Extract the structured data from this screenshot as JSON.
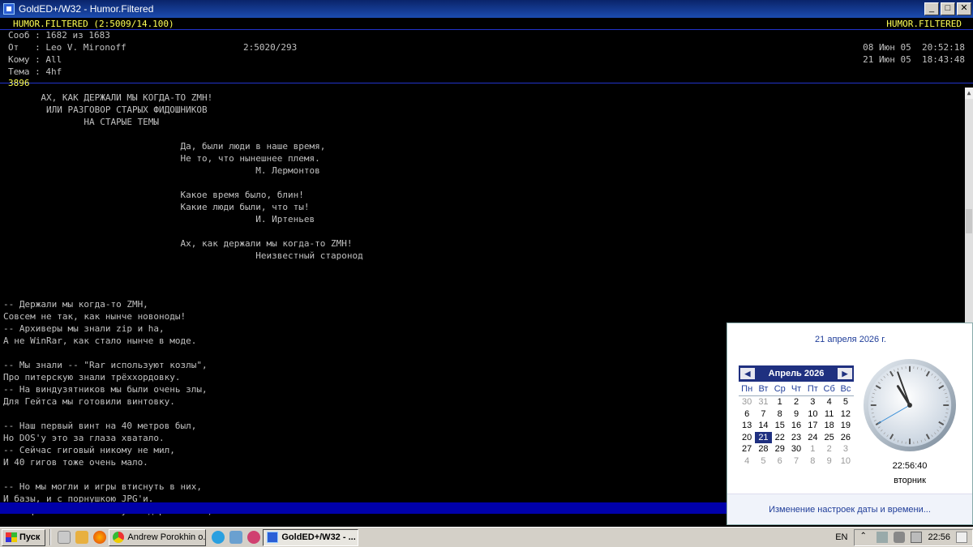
{
  "window": {
    "title": "GoldED+/W32 - Humor.Filtered",
    "minimize": "_",
    "maximize": "□",
    "close": "✕"
  },
  "header": {
    "area_left": "HUMOR.FILTERED (2:5009/14.100)",
    "area_right": "HUMOR.FILTERED",
    "msg_line": "Сооб : 1682 из 1683",
    "from_line": "От   : Leo V. Mironoff",
    "from_addr": "2:5020/293",
    "to_line": "Кому : All",
    "subj_line": "Тема : 4hf",
    "date_written": "08 Июн 05  20:52:18",
    "date_arrived": "21 Июн 05  18:43:48",
    "msg_number": "3896"
  },
  "body": {
    "lines": [
      "       АХ, КАК ДЕРЖАЛИ МЫ КОГДА-ТО ZMH!",
      "        ИЛИ РАЗГОВОР СТАРЫХ ФИДОШНИКОВ",
      "               НА СТАРЫЕ ТЕМЫ",
      "",
      "                                 Да, были люди в наше время,",
      "                                 Не то, что нынешнее племя.",
      "                                               М. Лермонтов",
      "",
      "                                 Какое время было, блин!",
      "                                 Какие люди были, что ты!",
      "                                               И. Иртеньев",
      "",
      "                                 Ах, как держали мы когда-то ZMH!",
      "                                               Неизвестный старонод",
      "",
      "",
      "",
      "-- Держали мы когда-то ZMH,",
      "Совсем не так, как нынче новоноды!",
      "-- Архиверы мы знали zip и ha,",
      "А не WinRar, как стало нынче в моде.",
      "",
      "-- Мы знали -- \"Rar используют козлы\",",
      "Про питерскую знали трёххордовку.",
      "-- На виндузятников мы были очень злы,",
      "Для Гейтса мы готовили винтовку.",
      "",
      "-- Наш первый винт на 40 метров был,",
      "Но DOS'у это за глаза хватало.",
      "-- Сейчас гиговый никому не мил,",
      "И 40 гигов тоже очень мало.",
      "",
      "-- Но мы могли и игры втиснуть в них,",
      "И базы, и с порнушкою JPG'и.",
      "-- А фильмы на винте пусть держит псих,"
    ]
  },
  "clock": {
    "date_link": "21 апреля 2026 г.",
    "month_label": "Апрель 2026",
    "prev": "◀",
    "next": "▶",
    "weekdays": [
      "Пн",
      "Вт",
      "Ср",
      "Чт",
      "Пт",
      "Сб",
      "Вс"
    ],
    "days": [
      [
        "30",
        "31",
        "1",
        "2",
        "3",
        "4",
        "5"
      ],
      [
        "6",
        "7",
        "8",
        "9",
        "10",
        "11",
        "12"
      ],
      [
        "13",
        "14",
        "15",
        "16",
        "17",
        "18",
        "19"
      ],
      [
        "20",
        "21",
        "22",
        "23",
        "24",
        "25",
        "26"
      ],
      [
        "27",
        "28",
        "29",
        "30",
        "1",
        "2",
        "3"
      ],
      [
        "4",
        "5",
        "6",
        "7",
        "8",
        "9",
        "10"
      ]
    ],
    "today": "21",
    "time": "22:56:40",
    "weekday": "вторник",
    "hands": {
      "hours": 22,
      "minutes": 56,
      "seconds": 40
    },
    "settings_link": "Изменение настроек даты и времени..."
  },
  "taskbar": {
    "start_label": "Пуск",
    "tasks": [
      {
        "label": "Andrew Porokhin o..."
      },
      {
        "label": "GoldED+/W32 - ..."
      }
    ],
    "lang": "EN",
    "time": "22:56"
  },
  "colors": {
    "console_bg": "#000000",
    "console_text": "#c0c0c0",
    "highlight_yellow": "#ffff55",
    "status_blue": "#0000aa",
    "calendar_blue": "#1f3080"
  }
}
